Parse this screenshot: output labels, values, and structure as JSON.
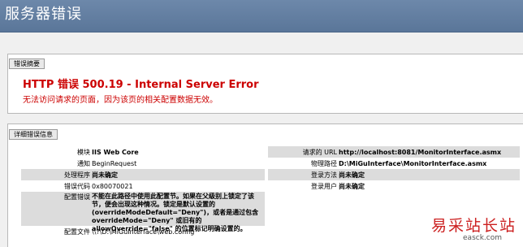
{
  "header": {
    "title": "服务器错误"
  },
  "summary": {
    "legend": "错误摘要",
    "title": "HTTP 错误 500.19 - Internal Server Error",
    "message": "无法访问请求的页面，因为该页的相关配置数据无效。"
  },
  "detail": {
    "legend": "详细错误信息",
    "left": {
      "module_label": "模块",
      "module_value": "IIS Web Core",
      "notify_label": "通知",
      "notify_value": "BeginRequest",
      "handler_label": "处理程序",
      "handler_value": "尚未确定",
      "code_label": "错误代码",
      "code_value": "0x80070021",
      "config_error_label": "配置错误",
      "config_error_value": "不能在此路径中使用此配置节。如果在父级别上锁定了该节，便会出现这种情况。锁定是默认设置的(overrideModeDefault=\"Deny\")，或者是通过包含 overrideMode=\"Deny\" 或旧有的 allowOverride=\"false\" 的位置标记明确设置的。",
      "config_file_label": "配置文件",
      "config_file_value": "\\\\?\\D:\\MiGuInterface\\web.config"
    },
    "right": {
      "url_label": "请求的 URL",
      "url_value": "http://localhost:8081/MonitorInterface.asmx",
      "path_label": "物理路径",
      "path_value": "D:\\MiGuInterface\\MonitorInterface.asmx",
      "logon_method_label": "登录方法",
      "logon_method_value": "尚未确定",
      "logon_user_label": "登录用户",
      "logon_user_value": "尚未确定"
    }
  },
  "watermark": {
    "cn": "易采站长站",
    "en": "easck.com"
  }
}
